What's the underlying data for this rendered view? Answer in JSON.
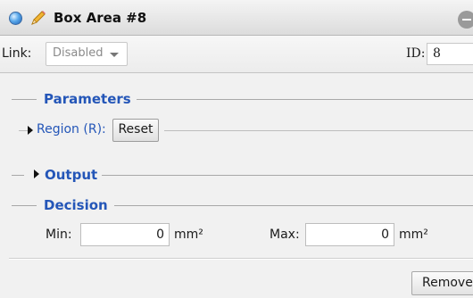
{
  "window": {
    "title": "Box Area #8"
  },
  "toolbar": {
    "link_label": "Link:",
    "link_value": "Disabled",
    "id_label": "ID:",
    "id_value": "8"
  },
  "parameters": {
    "title": "Parameters",
    "region_label": "Region (R):",
    "reset_label": "Reset"
  },
  "output": {
    "title": "Output"
  },
  "decision": {
    "title": "Decision",
    "min_label": "Min:",
    "min_value": "0",
    "min_unit": "mm²",
    "max_label": "Max:",
    "max_value": "0",
    "max_unit": "mm²"
  },
  "footer": {
    "remove_label": "Remove"
  },
  "colors": {
    "section_blue": "#2456b8",
    "title_bg": "#dcdcdc"
  },
  "icons": [
    "status-ball-icon",
    "pencil-icon",
    "collapse-icon",
    "expand-arrow-icon",
    "dropdown-arrow-icon"
  ]
}
